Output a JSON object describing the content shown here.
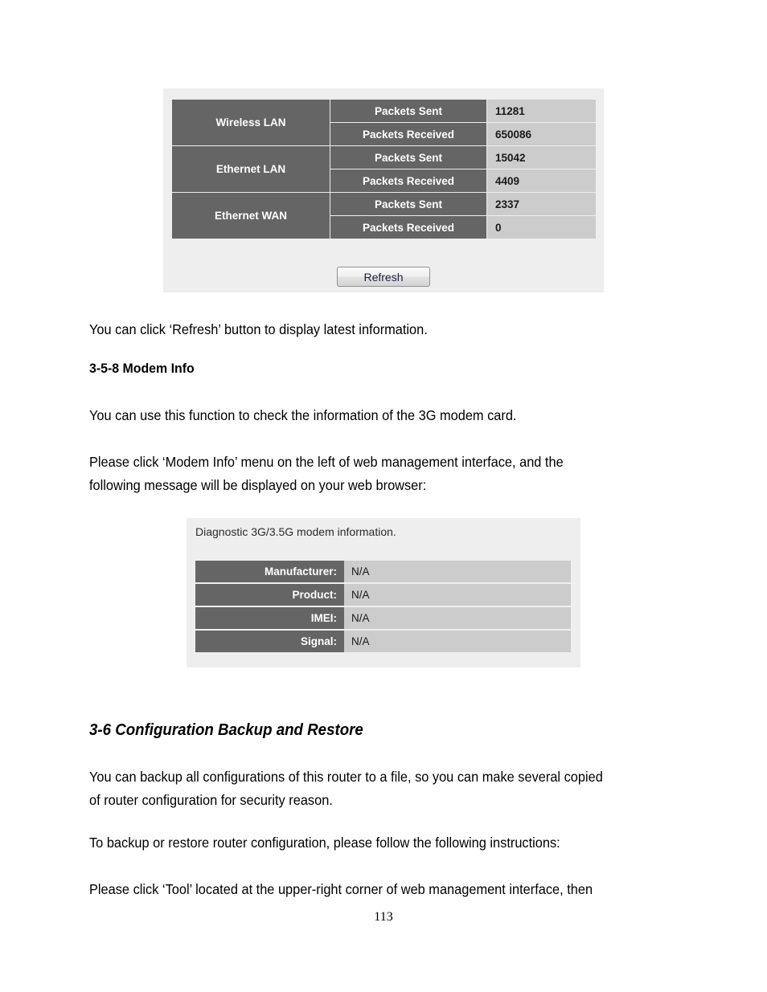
{
  "document": {
    "page_number": "113",
    "paragraphs": {
      "p_refresh_note": "You can click ‘Refresh’ button to display latest information.",
      "h_modem_info": "3-5-8 Modem Info",
      "p_modem_intro": "You can use this function to check the information of the 3G modem card.",
      "p_modem_click": "Please click ‘Modem Info’ menu on the left of web management interface, and the\nfollowing message will be displayed on your web browser:",
      "h_backup_restore": "3-6 Configuration Backup and Restore",
      "p_backup_intro": "You can backup all configurations of this router to a file, so you can make several copied\nof router configuration for security reason.",
      "p_backup_instructions": "To backup or restore router configuration, please follow the following instructions:",
      "p_tool_click": "Please click ‘Tool’ located at the upper-right corner of web management interface, then"
    }
  },
  "statistics_panel": {
    "rows": [
      {
        "category": "Wireless LAN",
        "metric": "Packets Sent",
        "value": "11281"
      },
      {
        "category": "Wireless LAN",
        "metric": "Packets Received",
        "value": "650086"
      },
      {
        "category": "Ethernet LAN",
        "metric": "Packets Sent",
        "value": "15042"
      },
      {
        "category": "Ethernet LAN",
        "metric": "Packets Received",
        "value": "4409"
      },
      {
        "category": "Ethernet WAN",
        "metric": "Packets Sent",
        "value": "2337"
      },
      {
        "category": "Ethernet WAN",
        "metric": "Packets Received",
        "value": "0"
      }
    ],
    "refresh_label": "Refresh"
  },
  "modem_panel": {
    "caption": "Diagnostic 3G/3.5G modem information.",
    "rows": [
      {
        "label": "Manufacturer:",
        "value": "N/A"
      },
      {
        "label": "Product:",
        "value": "N/A"
      },
      {
        "label": "IMEI:",
        "value": "N/A"
      },
      {
        "label": "Signal:",
        "value": "N/A"
      }
    ]
  },
  "colors": {
    "label_cell_bg": "#656565",
    "value_cell_bg": "#cccccc",
    "panel_bg": "#eeeeee",
    "label_text": "#ffffff"
  }
}
